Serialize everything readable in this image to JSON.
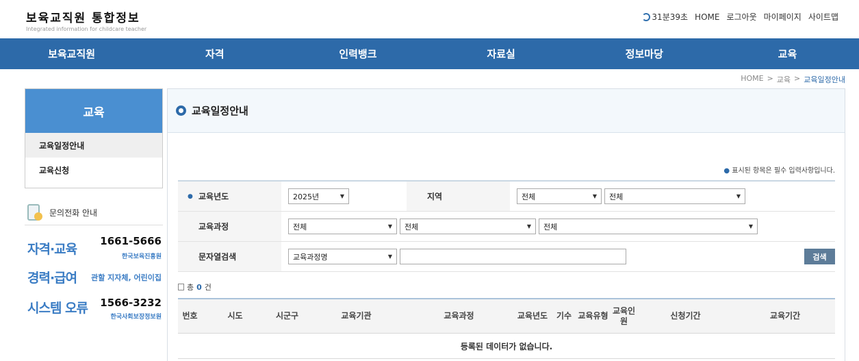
{
  "header": {
    "title": "보육교직원 통합정보",
    "subtitle": "Integrated information for childcare teacher",
    "timer": "31분39초",
    "links": [
      "HOME",
      "로그아웃",
      "마이페이지",
      "사이트맵"
    ]
  },
  "gnb": [
    "보육교직원",
    "자격",
    "인력뱅크",
    "자료실",
    "정보마당",
    "교육"
  ],
  "breadcrumb": [
    "HOME",
    ">",
    "교육",
    ">",
    "교육일정안내"
  ],
  "lnb": {
    "title": "교육",
    "items": [
      "교육일정안내",
      "교육신청"
    ]
  },
  "contact": {
    "title": "문의전화 안내",
    "rows": [
      {
        "category": "자격·교육",
        "number": "1661-5666",
        "org": "한국보육진흥원"
      },
      {
        "category": "경력·급여",
        "number": "",
        "org": "관할 지자체, 어린이집"
      },
      {
        "category": "시스템 오류",
        "number": "1566-3232",
        "org": "한국사회보장정보원"
      }
    ]
  },
  "content": {
    "title": "교육일정안내",
    "required_note": "표시된 항목은 필수 입력사항입니다.",
    "search": {
      "year_label": "교육년도",
      "year_value": "2025년",
      "region_label": "지역",
      "region_value1": "전체",
      "region_value2": "전체",
      "course_label": "교육과정",
      "course_value1": "전체",
      "course_value2": "전체",
      "course_value3": "전체",
      "text_label": "문자열검색",
      "text_type": "교육과정명",
      "button": "검색"
    },
    "total_prefix": "총",
    "total_count": "0",
    "total_suffix": "건",
    "table": {
      "headers": [
        "번호",
        "시도",
        "시군구",
        "교육기관",
        "교육과정",
        "교육년도",
        "기수",
        "교육유형",
        "교육인원",
        "신청기간",
        "교육기간"
      ],
      "empty": "등록된 데이터가 없습니다."
    }
  },
  "colors": {
    "brand": "#2d6aa9",
    "accent": "#4a8fd1"
  }
}
